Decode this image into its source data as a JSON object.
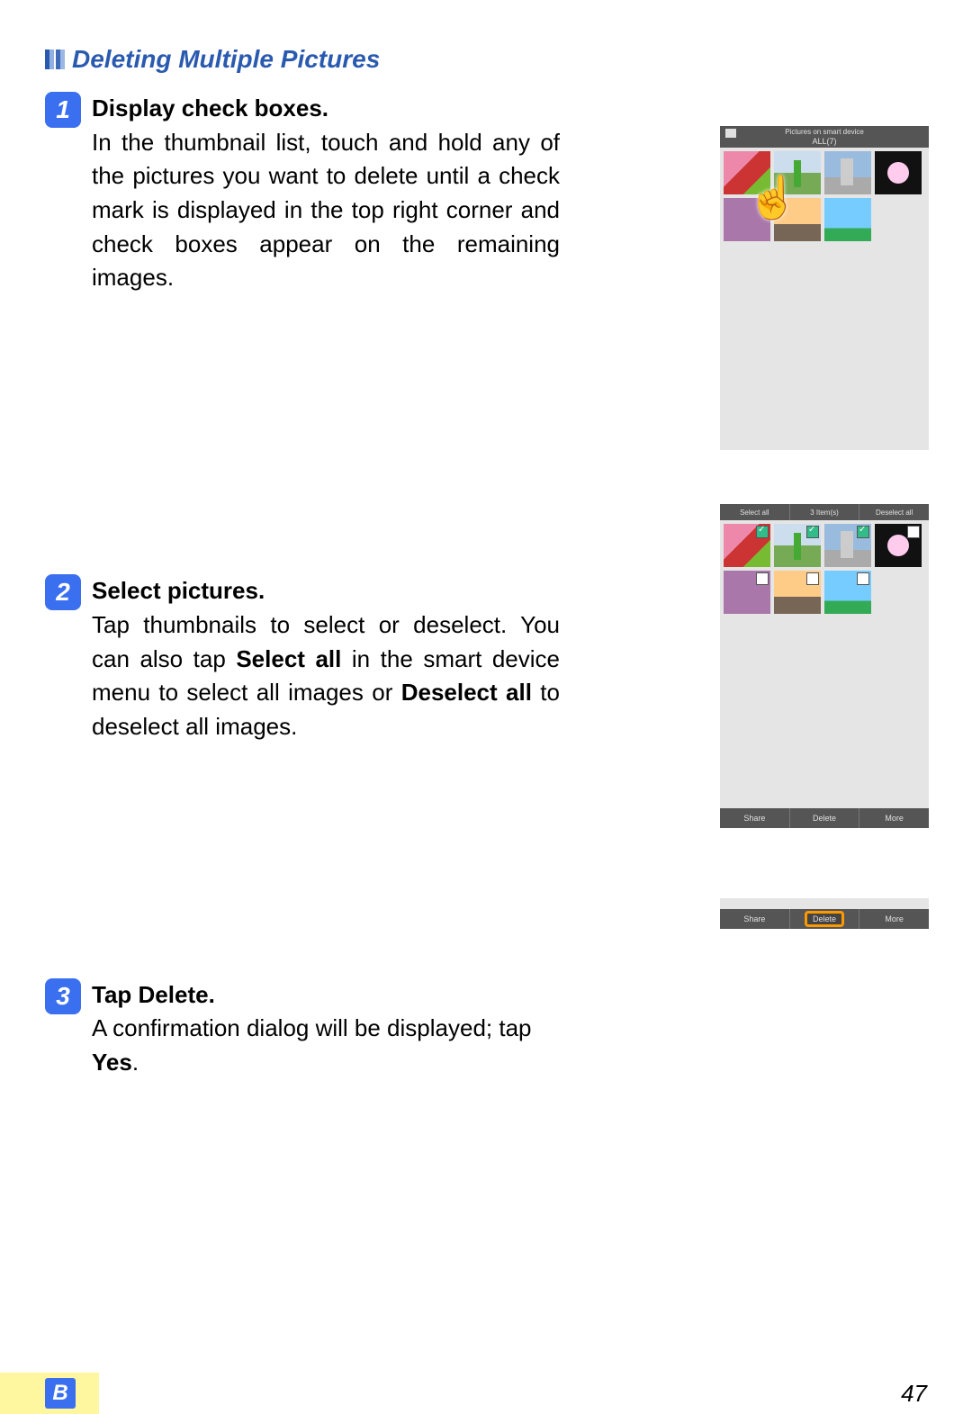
{
  "section_title": "Deleting Multiple Pictures",
  "steps": {
    "s1": {
      "num": "1",
      "heading": "Display check boxes.",
      "text": "In the thumbnail list, touch and hold any of the pictures you want to delete until a check mark is displayed in the top right corner and check boxes appear on the remaining images."
    },
    "s2": {
      "num": "2",
      "heading": "Select pictures.",
      "text_a": "Tap thumbnails to select or deselect. You can also tap ",
      "text_b": "Select all",
      "text_c": " in the smart device menu to select all images or ",
      "text_d": "De­select all",
      "text_e": " to deselect all images."
    },
    "s3": {
      "num": "3",
      "heading_a": "Tap ",
      "heading_b": "Delete",
      "heading_c": ".",
      "text_a": "A confirmation dialog will be displayed; tap ",
      "text_b": "Yes",
      "text_c": "."
    }
  },
  "phone1": {
    "header1": "Pictures on smart device",
    "header2": "ALL(7)"
  },
  "phone2": {
    "sel_all": "Select all",
    "count": "3 Item(s)",
    "desel_all": "Deselect all",
    "share": "Share",
    "delete": "Delete",
    "more": "More"
  },
  "bar3": {
    "share": "Share",
    "delete": "Delete",
    "more": "More"
  },
  "footer": {
    "badge": "B",
    "page": "47"
  }
}
